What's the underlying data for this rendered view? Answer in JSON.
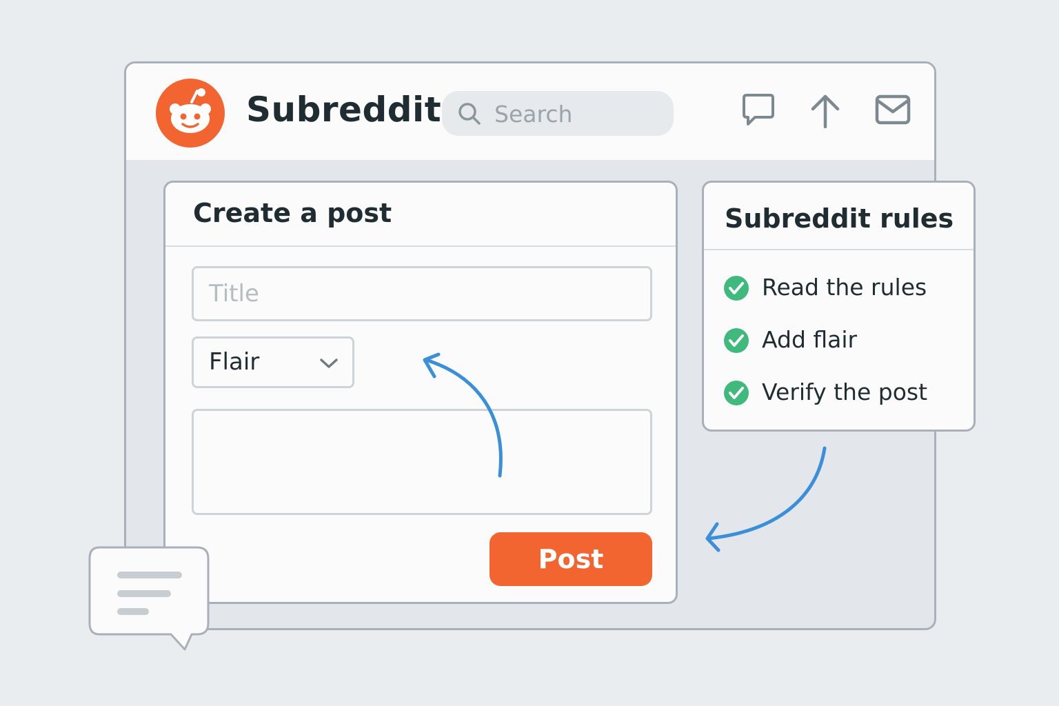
{
  "header": {
    "title": "Subreddit",
    "search": {
      "placeholder": "Search",
      "value": ""
    },
    "icons": [
      "chat-icon",
      "upvote-arrow-icon",
      "mail-icon"
    ]
  },
  "post_form": {
    "heading": "Create a post",
    "title_placeholder": "Title",
    "flair_label": "Flair",
    "body_value": "",
    "submit_label": "Post"
  },
  "rules": {
    "heading": "Subreddit rules",
    "items": [
      {
        "label": "Read the rules",
        "checked": true
      },
      {
        "label": "Add flair",
        "checked": true
      },
      {
        "label": "Verify the post",
        "checked": true
      }
    ]
  },
  "colors": {
    "brand": "#f26430",
    "check": "#3fb97c",
    "arrow": "#3b8fd9",
    "text": "#1f2d33"
  }
}
